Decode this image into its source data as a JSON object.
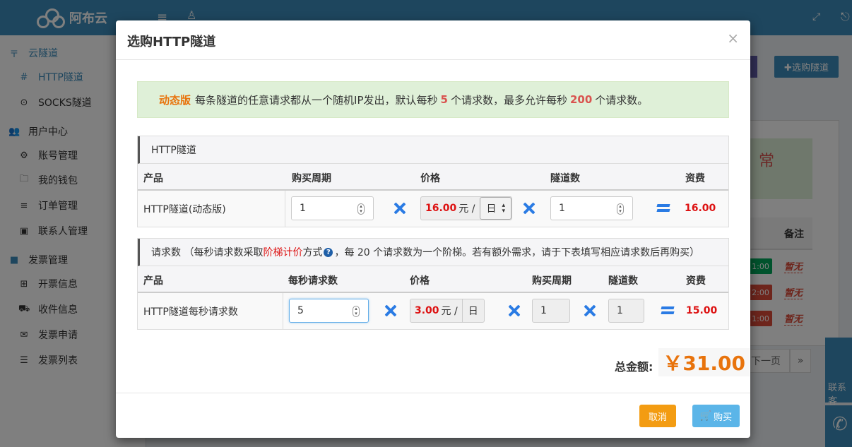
{
  "app": {
    "logo_text": "阿布云"
  },
  "sidebar": {
    "items": [
      {
        "label": "云隧道",
        "icon": "sliders-icon",
        "glyph": "〒",
        "kind": "group"
      },
      {
        "label": "HTTP隧道",
        "icon": "hash-icon",
        "glyph": "#",
        "kind": "sub-active"
      },
      {
        "label": "SOCKS隧道",
        "icon": "dot-circle-icon",
        "glyph": "⊙",
        "kind": "sub"
      },
      {
        "label": "用户中心",
        "icon": "users-icon",
        "glyph": "👥",
        "kind": "group"
      },
      {
        "label": "账号管理",
        "icon": "gear-icon",
        "glyph": "⚙",
        "kind": "sub"
      },
      {
        "label": "我的钱包",
        "icon": "folder-icon",
        "glyph": "🗀",
        "kind": "sub"
      },
      {
        "label": "订单管理",
        "icon": "list-icon",
        "glyph": "≡",
        "kind": "sub"
      },
      {
        "label": "联系人管理",
        "icon": "id-card-icon",
        "glyph": "▣",
        "kind": "sub"
      },
      {
        "label": "发票管理",
        "icon": "folder-filled-icon",
        "glyph": "■",
        "kind": "group"
      },
      {
        "label": "开票信息",
        "icon": "table-icon",
        "glyph": "⊞",
        "kind": "sub"
      },
      {
        "label": "收件信息",
        "icon": "truck-icon",
        "glyph": "⛟",
        "kind": "sub"
      },
      {
        "label": "发票申请",
        "icon": "envelope-icon",
        "glyph": "✉",
        "kind": "sub"
      },
      {
        "label": "发票列表",
        "icon": "list-ul-icon",
        "glyph": "☰",
        "kind": "sub"
      }
    ]
  },
  "background": {
    "buy_tunnel_button": "✚选购隧道",
    "green_text": "常",
    "remark_header": "备注",
    "time_badges": [
      "1:00",
      "2:00",
      "1:00"
    ],
    "none_tags": [
      "暂无",
      "暂无",
      "暂无"
    ],
    "next_page": "下一页",
    "last_page": "»",
    "contact_text": "联系客"
  },
  "modal": {
    "title": "选购HTTP隧道",
    "close": "×",
    "alert": {
      "tag": "动态版",
      "text1": "每条隧道的任意请求都从一个随机IP发出，默认每秒",
      "num1": "5",
      "text2": "个请求数，最多允许每秒",
      "num2": "200",
      "text3": "个请求数。"
    },
    "tunnel_section": {
      "title": "HTTP隧道",
      "headers": [
        "产品",
        "购买周期",
        "价格",
        "隧道数",
        "资费"
      ],
      "row": {
        "product": "HTTP隧道(动态版)",
        "period": "1",
        "price": "16.00",
        "unit": "元 /",
        "period_unit": "日",
        "count": "1",
        "fee": "16.00"
      }
    },
    "request_section": {
      "title_prefix": "请求数 （每秒请求数采取",
      "title_red": "阶梯计价",
      "title_mid": "方式",
      "title_suffix": "，每 20 个请求数为一个阶梯。若有额外需求，请于下表填写相应请求数后再购买）",
      "help_icon": "?",
      "headers": [
        "产品",
        "每秒请求数",
        "价格",
        "购买周期",
        "隧道数",
        "资费"
      ],
      "row": {
        "product": "HTTP隧道每秒请求数",
        "requests": "5",
        "price": "3.00",
        "unit": "元 /",
        "period_unit": "日",
        "period": "1",
        "count": "1",
        "fee": "15.00"
      }
    },
    "total": {
      "label": "总金额:",
      "amount": "￥31.00"
    },
    "footer": {
      "cancel": "取消",
      "buy": "购买",
      "buy_icon": "cart-icon"
    }
  }
}
